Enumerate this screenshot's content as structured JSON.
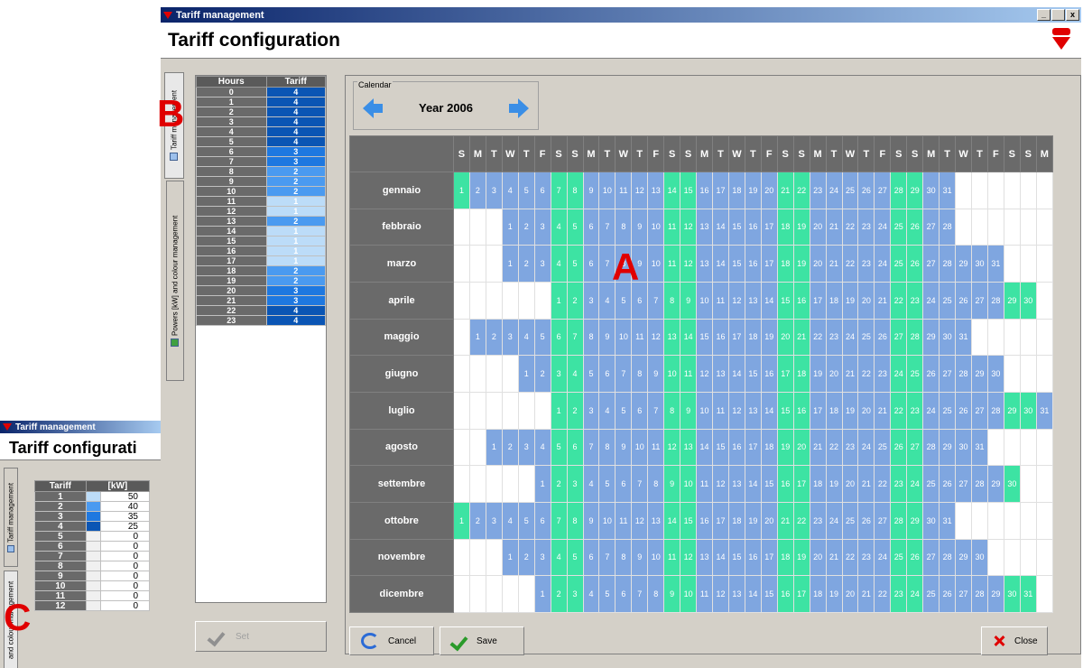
{
  "window": {
    "title": "Tariff management",
    "header": "Tariff configuration",
    "controls": [
      "_",
      " ",
      "x"
    ]
  },
  "tabs": [
    {
      "label": "Tariff management",
      "icon": "grid-icon",
      "active": true
    },
    {
      "label": "Powers [kW] and colour management",
      "icon": "chart-icon",
      "active": false
    }
  ],
  "hours_table": {
    "headers": [
      "Hours",
      "Tariff"
    ],
    "rows": [
      {
        "hour": "0",
        "tariff": "4"
      },
      {
        "hour": "1",
        "tariff": "4"
      },
      {
        "hour": "2",
        "tariff": "4"
      },
      {
        "hour": "3",
        "tariff": "4"
      },
      {
        "hour": "4",
        "tariff": "4"
      },
      {
        "hour": "5",
        "tariff": "4"
      },
      {
        "hour": "6",
        "tariff": "3"
      },
      {
        "hour": "7",
        "tariff": "3"
      },
      {
        "hour": "8",
        "tariff": "2"
      },
      {
        "hour": "9",
        "tariff": "2"
      },
      {
        "hour": "10",
        "tariff": "2"
      },
      {
        "hour": "11",
        "tariff": "1"
      },
      {
        "hour": "12",
        "tariff": "1"
      },
      {
        "hour": "13",
        "tariff": "2"
      },
      {
        "hour": "14",
        "tariff": "1"
      },
      {
        "hour": "15",
        "tariff": "1"
      },
      {
        "hour": "16",
        "tariff": "1"
      },
      {
        "hour": "17",
        "tariff": "1"
      },
      {
        "hour": "18",
        "tariff": "2"
      },
      {
        "hour": "19",
        "tariff": "2"
      },
      {
        "hour": "20",
        "tariff": "3"
      },
      {
        "hour": "21",
        "tariff": "3"
      },
      {
        "hour": "22",
        "tariff": "4"
      },
      {
        "hour": "23",
        "tariff": "4"
      }
    ]
  },
  "tariff_colors": {
    "1": "#bcdcf8",
    "2": "#4a9af0",
    "3": "#1e78e0",
    "4": "#0a55b4"
  },
  "set_button": "Set",
  "calendar": {
    "group_label": "Calendar",
    "year": "Year 2006",
    "day_headers": [
      "S",
      "M",
      "T",
      "W",
      "T",
      "F",
      "S",
      "S",
      "M",
      "T",
      "W",
      "T",
      "F",
      "S",
      "S",
      "M",
      "T",
      "W",
      "T",
      "F",
      "S",
      "S",
      "M",
      "T",
      "W",
      "T",
      "F",
      "S",
      "S",
      "M",
      "T",
      "W",
      "T",
      "F",
      "S",
      "S",
      "M"
    ],
    "months": [
      {
        "name": "gennaio",
        "offset": 0,
        "days": 31
      },
      {
        "name": "febbraio",
        "offset": 3,
        "days": 28
      },
      {
        "name": "marzo",
        "offset": 3,
        "days": 31
      },
      {
        "name": "aprile",
        "offset": 6,
        "days": 30
      },
      {
        "name": "maggio",
        "offset": 1,
        "days": 31
      },
      {
        "name": "giugno",
        "offset": 4,
        "days": 30
      },
      {
        "name": "luglio",
        "offset": 6,
        "days": 31
      },
      {
        "name": "agosto",
        "offset": 2,
        "days": 31
      },
      {
        "name": "settembre",
        "offset": 5,
        "days": 30
      },
      {
        "name": "ottobre",
        "offset": 0,
        "days": 31
      },
      {
        "name": "novembre",
        "offset": 3,
        "days": 30
      },
      {
        "name": "dicembre",
        "offset": 5,
        "days": 31
      }
    ],
    "colors": {
      "weekday": "#7fa6e0",
      "weekend": "#3de3a3",
      "empty": "#ffffff"
    }
  },
  "buttons": {
    "cancel": "Cancel",
    "save": "Save",
    "close": "Close"
  },
  "annotations": {
    "a": "A",
    "b": "B",
    "c": "C"
  },
  "inset": {
    "title": "Tariff management",
    "header": "Tariff configurati",
    "tab_labels": [
      "Tariff management",
      "and colour management"
    ],
    "headers": [
      "Tariff",
      "[kW]"
    ],
    "rows": [
      {
        "tariff": "1",
        "kw": "50",
        "color": "#bcdcf8"
      },
      {
        "tariff": "2",
        "kw": "40",
        "color": "#4a9af0"
      },
      {
        "tariff": "3",
        "kw": "35",
        "color": "#1e78e0"
      },
      {
        "tariff": "4",
        "kw": "25",
        "color": "#0a55b4"
      },
      {
        "tariff": "5",
        "kw": "0",
        "color": "#f0f0f0"
      },
      {
        "tariff": "6",
        "kw": "0",
        "color": "#f0f0f0"
      },
      {
        "tariff": "7",
        "kw": "0",
        "color": "#f0f0f0"
      },
      {
        "tariff": "8",
        "kw": "0",
        "color": "#f0f0f0"
      },
      {
        "tariff": "9",
        "kw": "0",
        "color": "#f0f0f0"
      },
      {
        "tariff": "10",
        "kw": "0",
        "color": "#f0f0f0"
      },
      {
        "tariff": "11",
        "kw": "0",
        "color": "#f0f0f0"
      },
      {
        "tariff": "12",
        "kw": "0",
        "color": "#f0f0f0"
      }
    ]
  }
}
